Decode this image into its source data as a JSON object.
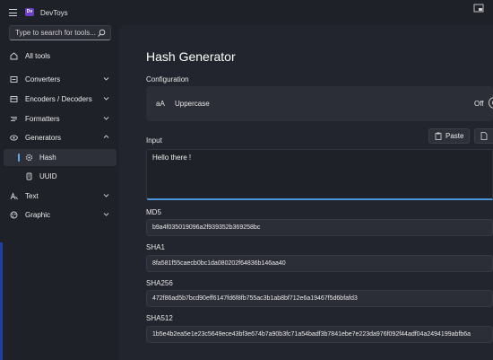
{
  "app": {
    "title": "DevToys",
    "logo_text": "Dv"
  },
  "sidebar": {
    "search_placeholder": "Type to search for tools...",
    "items": [
      {
        "label": "All tools",
        "icon": "home-icon"
      },
      {
        "label": "Converters",
        "icon": "converter-icon"
      },
      {
        "label": "Encoders / Decoders",
        "icon": "encoder-icon"
      },
      {
        "label": "Formatters",
        "icon": "formatter-icon"
      },
      {
        "label": "Generators",
        "icon": "generator-icon"
      },
      {
        "label": "Hash",
        "icon": "hash-icon"
      },
      {
        "label": "UUID",
        "icon": "uuid-icon"
      },
      {
        "label": "Text",
        "icon": "text-icon"
      },
      {
        "label": "Graphic",
        "icon": "graphic-icon"
      }
    ],
    "selected": "Hash"
  },
  "main": {
    "title": "Hash Generator",
    "configuration_label": "Configuration",
    "config": {
      "icon_text": "aA",
      "label": "Uppercase",
      "toggle_state": "Off"
    },
    "input_label": "Input",
    "paste_label": "Paste",
    "input_value": "Hello there !",
    "outputs": [
      {
        "label": "MD5",
        "value": "b9a4f035019096a2f939352b369258bc"
      },
      {
        "label": "SHA1",
        "value": "8fa581f55caecb0bc1da080202f64836b146aa40"
      },
      {
        "label": "SHA256",
        "value": "472f86ad5b7bcd90eff6147fd6f8fb755ac3b1ab8bf712e6a19467f5d6bfafd3"
      },
      {
        "label": "SHA512",
        "value": "1b5e4b2ea5e1e23c5649ece43bf3e674b7a90b3fc71a54badf3b7841ebe7e223da976f092f44adf04a2494199abfb6a"
      }
    ]
  },
  "colors": {
    "accent": "#4c95d8",
    "selection_bar": "#62a8e6",
    "background": "#1f2129",
    "card": "#2c2e37"
  }
}
